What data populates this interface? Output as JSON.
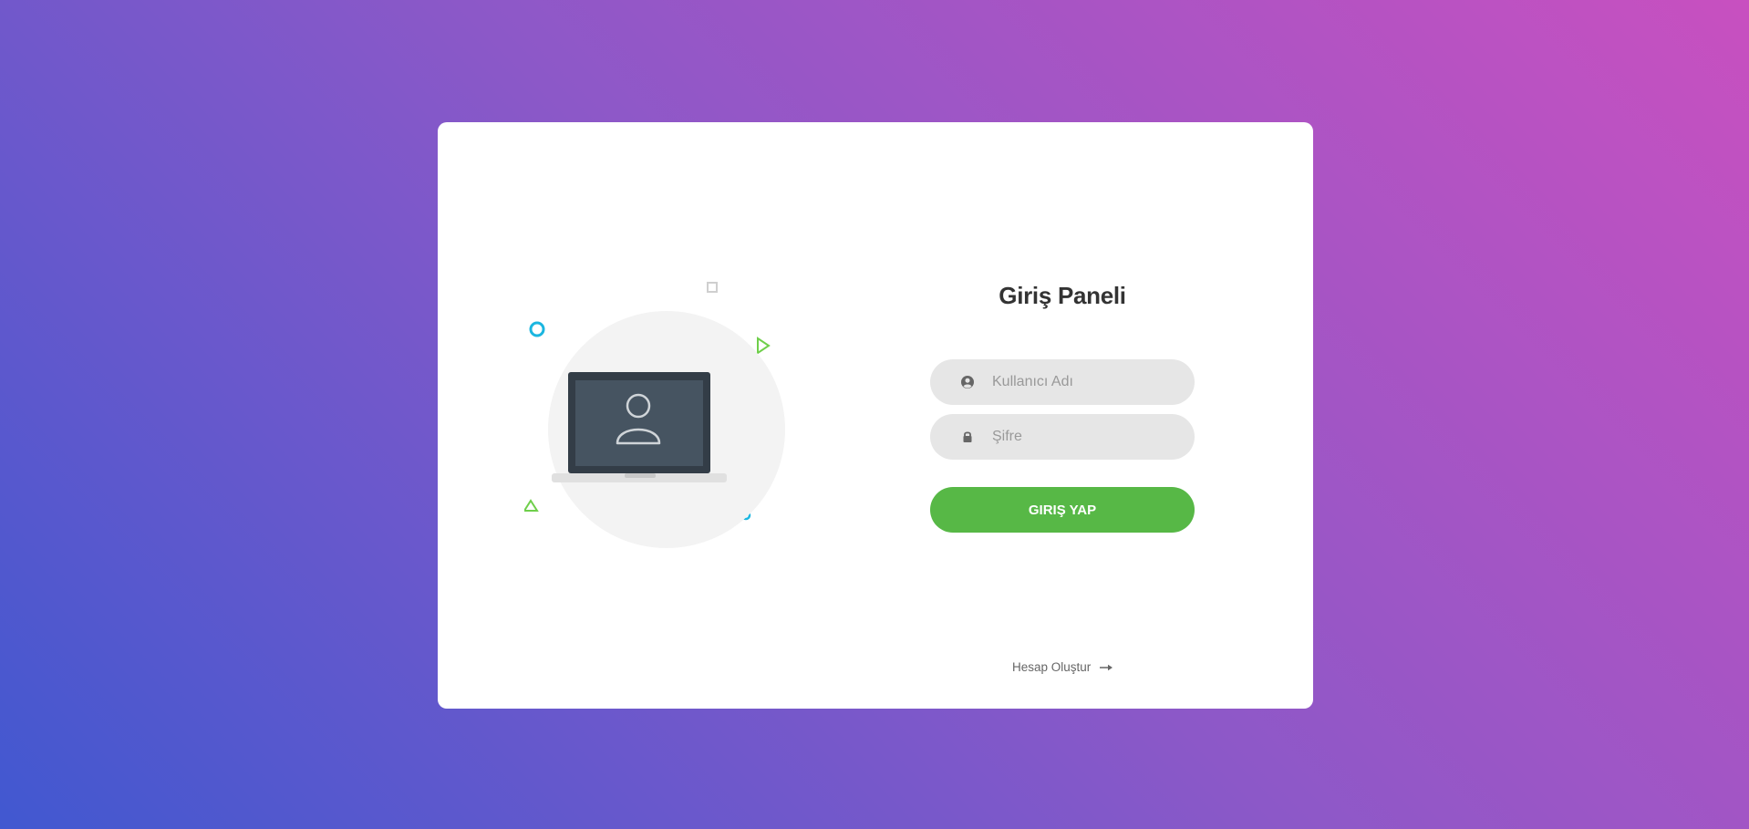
{
  "login": {
    "title": "Giriş Paneli",
    "username": {
      "placeholder": "Kullanıcı Adı",
      "value": "",
      "icon": "user-circle-icon"
    },
    "password": {
      "placeholder": "Şifre",
      "value": "",
      "icon": "lock-icon"
    },
    "submit_label": "GIRIŞ YAP",
    "signup_label": "Hesap Oluştur",
    "signup_icon": "arrow-right-icon"
  },
  "illustration": {
    "icon": "laptop-user-icon"
  },
  "colors": {
    "accent": "#57b846",
    "field_bg": "#e6e6e6",
    "title": "#333333",
    "gradient_start": "#4158d0",
    "gradient_end": "#c850c0",
    "decor_blue": "#1bb6e0",
    "decor_green": "#6fcf4b"
  }
}
